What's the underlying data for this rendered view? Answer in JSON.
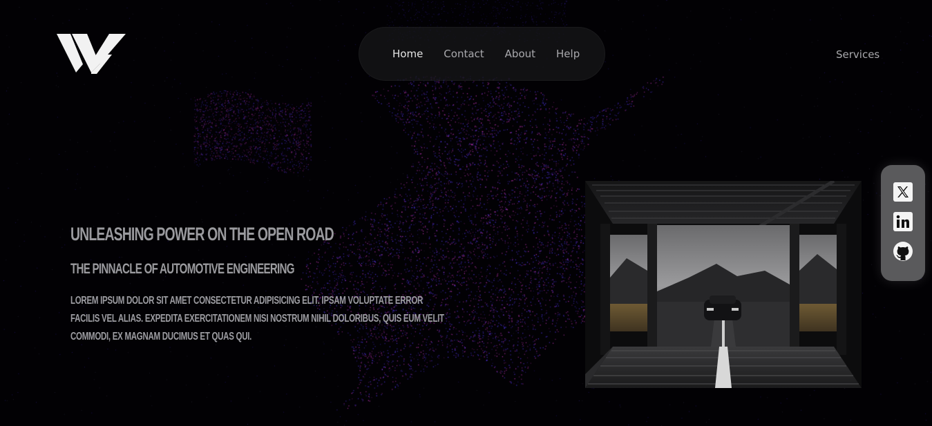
{
  "brand": {
    "logo_icon": "wy-logo-icon"
  },
  "nav": {
    "items": [
      {
        "label": "Home",
        "active": true
      },
      {
        "label": "Contact",
        "active": false
      },
      {
        "label": "About",
        "active": false
      },
      {
        "label": "Help",
        "active": false
      }
    ],
    "services_label": "Services"
  },
  "hero": {
    "title": "Unleashing Power on the Open Road",
    "subtitle": "The Pinnacle of Automotive Engineering",
    "body": "Lorem ipsum dolor sit amet consectetur adipisicing elit. Ipsam voluptate error facilis vel alias. Expedita exercitationem nisi nostrum nihil doloribus, quis eum velit commodi, ex magnam ducimus et quas qui."
  },
  "media": {
    "image_icon": "car-tunnel-image"
  },
  "social": {
    "items": [
      {
        "icon": "x-twitter-icon"
      },
      {
        "icon": "linkedin-icon"
      },
      {
        "icon": "github-icon"
      }
    ]
  },
  "colors": {
    "background": "#020104",
    "particle_pink": "#d23cc8",
    "particle_blue": "#5a3cff",
    "text_muted": "#9a9a9e",
    "social_bar": "#5a5a5c"
  }
}
